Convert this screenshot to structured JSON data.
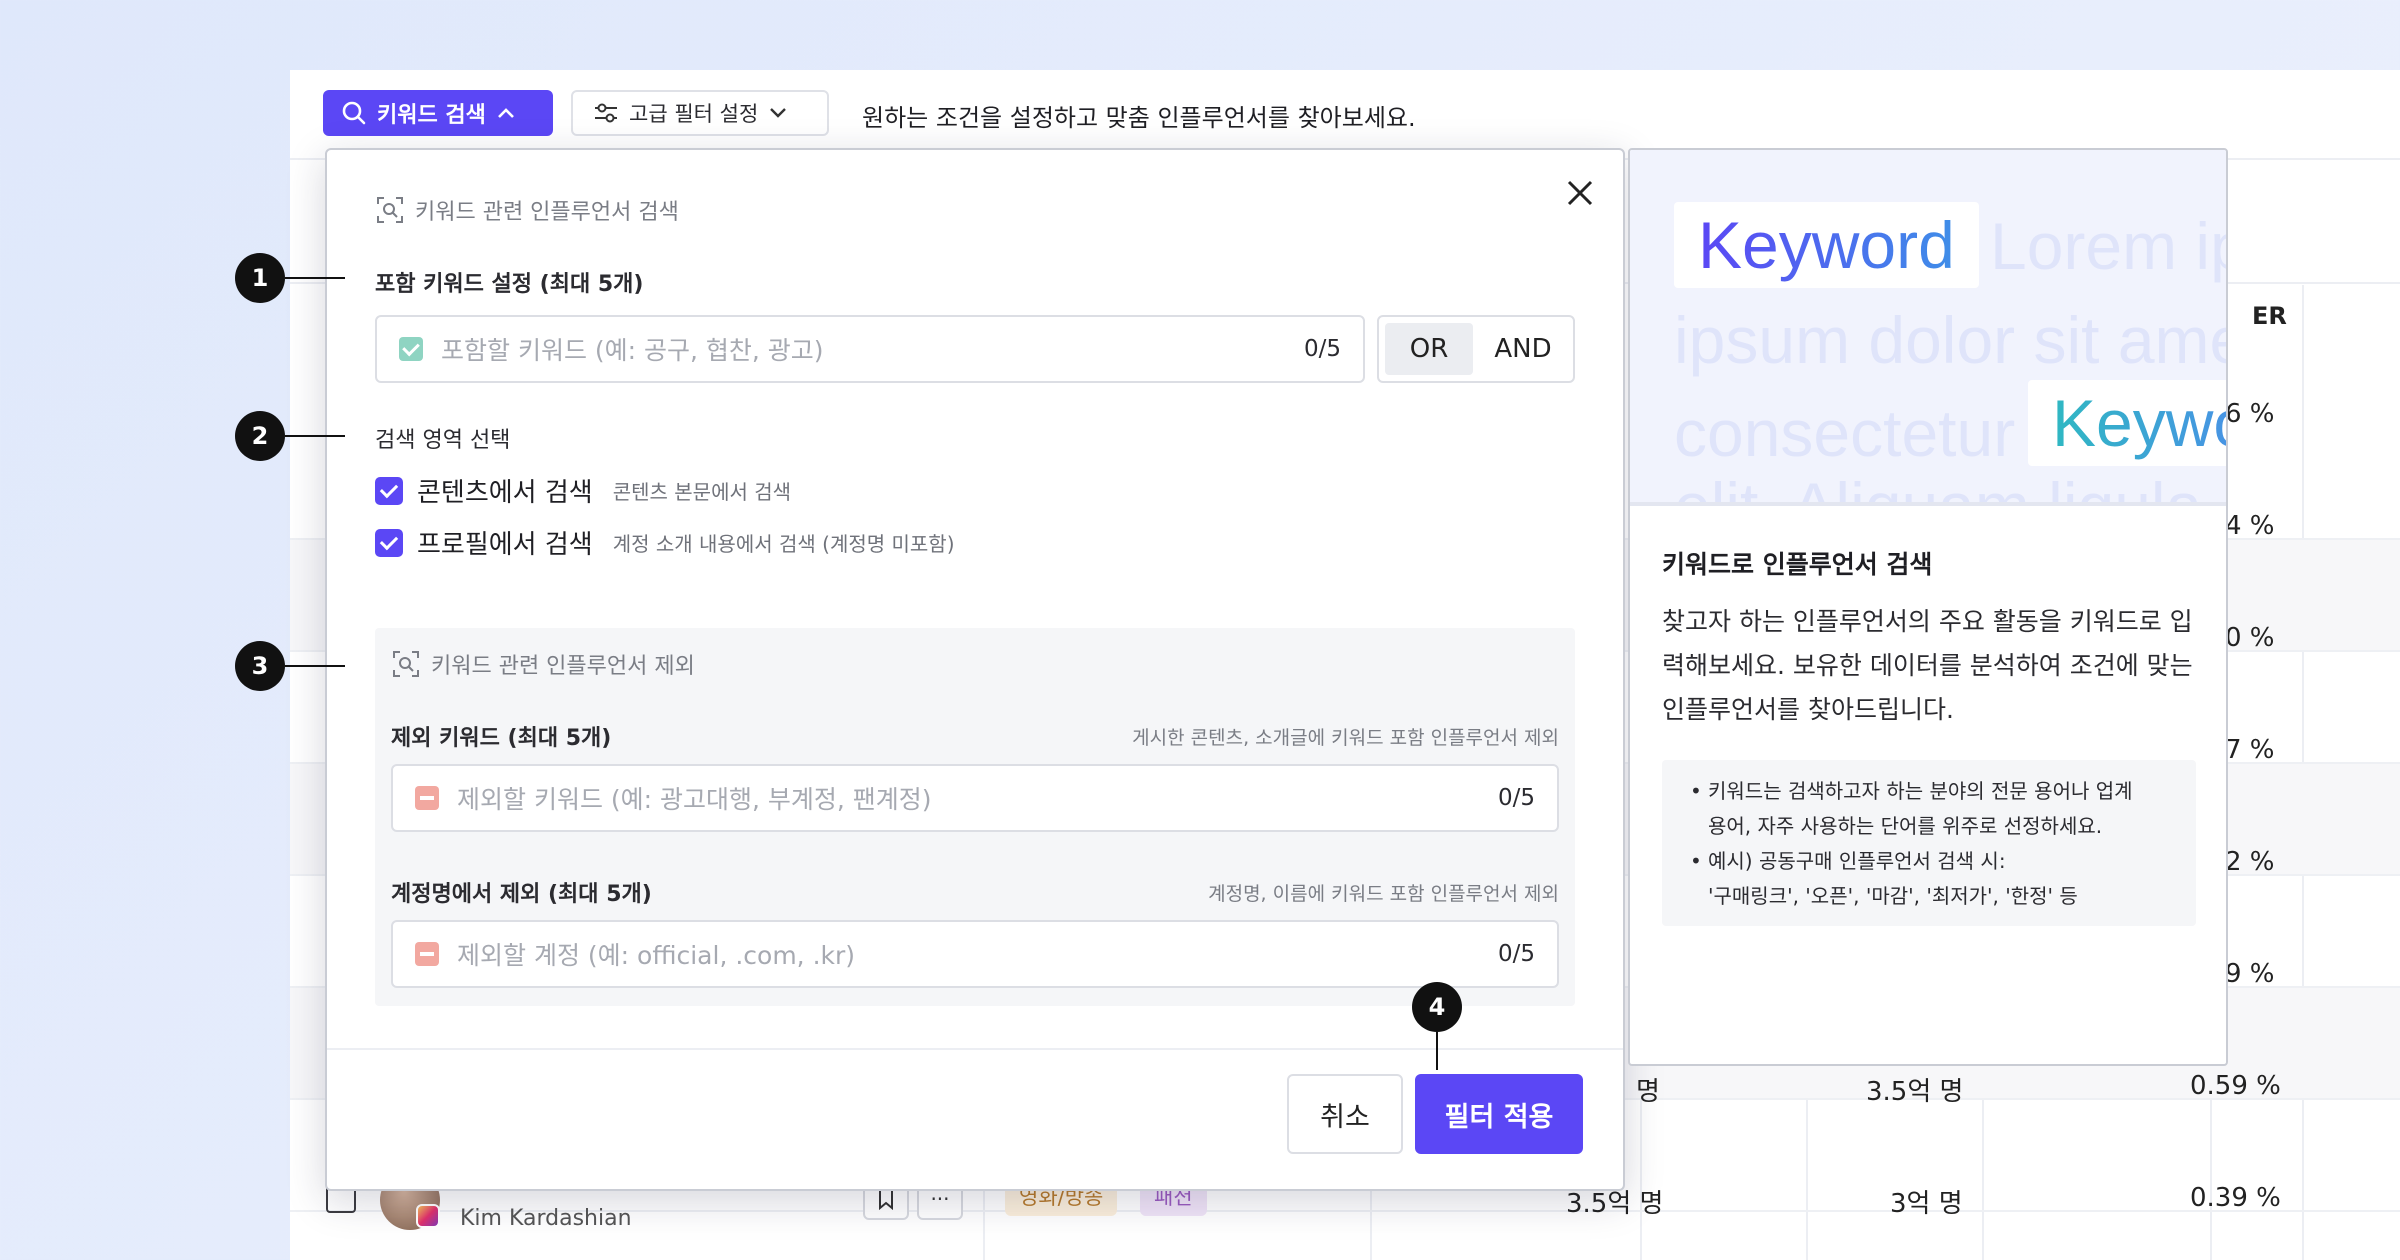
{
  "topbar": {
    "keyword_search_label": "키워드 검색",
    "advanced_filter_label": "고급 필터 설정",
    "hint": "원하는 조건을 설정하고 맞춤 인플루언서를 찾아보세요."
  },
  "table": {
    "er_header": "ER",
    "er_values": [
      "6 %",
      "4 %",
      "0 %",
      "7 %",
      "2 %",
      "9 %",
      "0.59 %",
      "0.39 %"
    ],
    "row7": {
      "col_a": "명",
      "col_b": "3.5억 명"
    },
    "row8": {
      "name": "Kim Kardashian",
      "tag1": "영화/방송",
      "tag2": "패션",
      "col_a": "3.5억 명",
      "col_b": "3억 명"
    }
  },
  "modal": {
    "section_include_title": "키워드 관련 인플루언서 검색",
    "include_label": "포함 키워드 설정 (최대 5개)",
    "include_placeholder": "포함할 키워드 (예: 공구, 협찬, 광고)",
    "include_count": "0/5",
    "or_label": "OR",
    "and_label": "AND",
    "area_label": "검색 영역 선택",
    "area_content_label": "콘텐츠에서 검색",
    "area_content_desc": "콘텐츠 본문에서 검색",
    "area_profile_label": "프로필에서 검색",
    "area_profile_desc": "계정 소개 내용에서 검색 (계정명 미포함)",
    "section_exclude_title": "키워드 관련 인플루언서 제외",
    "exclude_kw_label": "제외 키워드 (최대 5개)",
    "exclude_kw_desc": "게시한 콘텐츠, 소개글에 키워드 포함 인플루언서 제외",
    "exclude_kw_placeholder": "제외할 키워드 (예: 광고대행, 부계정, 팬계정)",
    "exclude_kw_count": "0/5",
    "exclude_acc_label": "계정명에서 제외 (최대 5개)",
    "exclude_acc_desc": "계정명, 이름에 키워드 포함 인플루언서 제외",
    "exclude_acc_placeholder": "제외할 계정 (예: official, .com, .kr)",
    "exclude_acc_count": "0/5",
    "cancel_label": "취소",
    "apply_label": "필터 적용"
  },
  "callouts": [
    "1",
    "2",
    "3",
    "4"
  ],
  "help": {
    "hero_keyword": "Keyword",
    "hero_keyword2": "Keywo",
    "hero_line1": "Lorem ip",
    "hero_line2": "ipsum dolor sit ame",
    "hero_line3": "consectetur",
    "hero_line4": "elit. Aliquam ligula",
    "title": "키워드로 인플루언서 검색",
    "body": "찾고자 하는 인플루언서의 주요 활동을 키워드로 입력해보세요. 보유한 데이터를 분석하여 조건에 맞는 인플루언서를 찾아드립니다.",
    "tip1": "키워드는 검색하고자 하는 분야의 전문 용어나 업계",
    "tip1_cont": "용어, 자주 사용하는 단어를 위주로 선정하세요.",
    "tip2": "예시) 공동구매 인플루언서 검색 시:",
    "tip2_cont": "'구매링크', '오픈', '마감', '최저가', '한정' 등"
  },
  "colors": {
    "accent": "#5b47f5",
    "callout": "#111111",
    "include_check": "#8fd4c2",
    "exclude_minus": "#f2a8a0"
  },
  "icons": [
    "search-icon",
    "chevron-up-icon",
    "sliders-icon",
    "chevron-down-icon",
    "close-icon",
    "scan-search-icon",
    "check-icon",
    "minus-icon",
    "bookmark-icon",
    "more-icon",
    "instagram-icon"
  ]
}
